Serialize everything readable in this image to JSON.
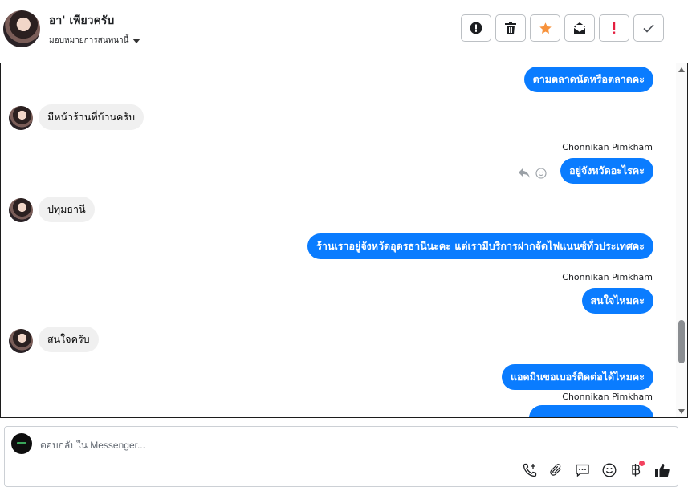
{
  "contact": {
    "name": "อา' เพียวครับ",
    "assign_label": "มอบหมายการสนทนานี้"
  },
  "toolbar": {
    "buttons": [
      {
        "icon": "alert-circle-icon",
        "label": "Mark as spam"
      },
      {
        "icon": "trash-icon",
        "label": "Delete"
      },
      {
        "icon": "star-icon",
        "label": "Star",
        "color": "#f7923b"
      },
      {
        "icon": "envelope-icon",
        "label": "Mark as unread"
      },
      {
        "icon": "exclamation-icon",
        "label": "Follow up",
        "color": "#e41e3f"
      },
      {
        "icon": "check-icon",
        "label": "Done"
      }
    ]
  },
  "messages": [
    {
      "dir": "out",
      "text": "ตามตลาดนัดหรือตลาดคะ"
    },
    {
      "dir": "in",
      "text": "มีหน้าร้านที่บ้านครับ"
    },
    {
      "dir": "out",
      "sender": "Chonnikan Pimkham",
      "text": "อยู่จังหวัดอะไรคะ"
    },
    {
      "dir": "in",
      "text": "ปทุมธานี"
    },
    {
      "dir": "out",
      "text": "ร้านเราอยู่จังหวัดอุดรธานีนะคะ แต่เรามีบริการฝากจัดไฟแนนซ์ทั่วประเทศคะ"
    },
    {
      "dir": "out",
      "sender": "Chonnikan Pimkham",
      "text": "สนใจไหมคะ"
    },
    {
      "dir": "in",
      "text": "สนใจครับ"
    },
    {
      "dir": "out",
      "text": "แอดมินขอเบอร์ติดต่อได้ไหมคะ"
    },
    {
      "dir": "out",
      "sender": "Chonnikan Pimkham",
      "text": ""
    }
  ],
  "composer": {
    "placeholder": "ตอบกลับใน Messenger...",
    "tools": [
      "phone-plus-icon",
      "paperclip-icon",
      "saved-reply-icon",
      "emoji-icon",
      "baht-payment-icon",
      "thumbs-up-icon"
    ]
  },
  "colors": {
    "outgoing_bubble": "#0a7cff",
    "incoming_bubble": "#f0f0f0",
    "like": "#1c1e21"
  }
}
